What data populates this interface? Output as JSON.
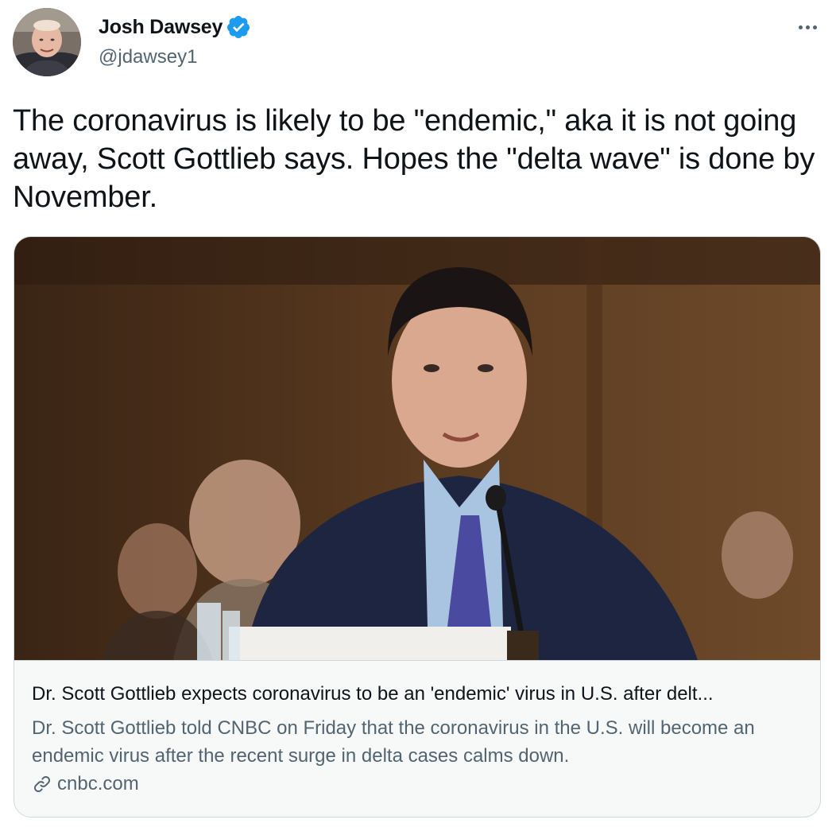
{
  "author": {
    "display_name": "Josh Dawsey",
    "handle": "@jdawsey1",
    "verified": true
  },
  "tweet": {
    "text": "The coronavirus is likely to be \"endemic,\" aka it is not going away, Scott Gottlieb says. Hopes the \"delta wave\" is done by November."
  },
  "card": {
    "title": "Dr. Scott Gottlieb expects coronavirus to be an 'endemic' virus in U.S. after delt...",
    "description": "Dr. Scott Gottlieb told CNBC on Friday that the coronavirus in the U.S. will become an endemic virus after the recent surge in delta cases calms down.",
    "domain": "cnbc.com"
  },
  "icons": {
    "verified": "verified-badge-icon",
    "more": "more-options-icon",
    "link": "link-icon"
  },
  "colors": {
    "accent": "#1d9bf0",
    "text_primary": "#0f1419",
    "text_secondary": "#536471",
    "border": "#cfd9de",
    "card_bg": "#f7f9f9"
  }
}
